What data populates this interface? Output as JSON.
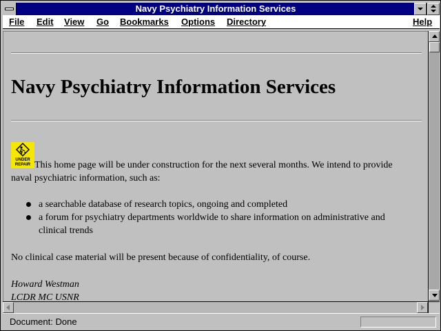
{
  "window": {
    "title": "Navy Psychiatry Information Services"
  },
  "menu": {
    "items": [
      "File",
      "Edit",
      "View",
      "Go",
      "Bookmarks",
      "Options",
      "Directory"
    ],
    "help": "Help"
  },
  "page": {
    "heading": "Navy Psychiatry Information Services",
    "icon": {
      "name": "under-repair-icon",
      "label_line1": "UNDER",
      "label_line2": "REPAIR",
      "color": "#f6e700"
    },
    "intro_line1": "This home page will be under construction for the next several months. We intend to provide",
    "intro_line2": "naval psychiatric information, such as:",
    "list": [
      {
        "line1": "a searchable database of research topics, ongoing and completed",
        "line2": ""
      },
      {
        "line1": "a forum for psychiatry departments worldwide to share information on administrative and",
        "line2": "clinical trends"
      }
    ],
    "note": "No clinical case material will be present because of confidentiality, of course.",
    "signature_name": "Howard Westman",
    "signature_title": "LCDR MC USNR"
  },
  "status": {
    "text": "Document: Done"
  },
  "colors": {
    "titlebar": "#000080",
    "background": "#c0c0c0"
  }
}
